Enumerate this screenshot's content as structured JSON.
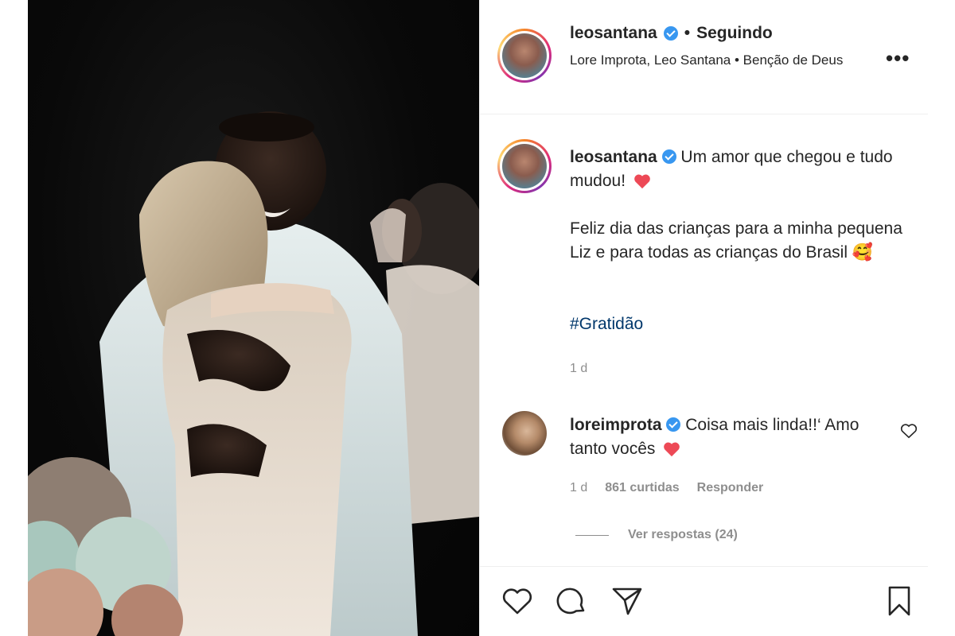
{
  "post": {
    "username": "leosantana",
    "follow_separator": "•",
    "follow_status": "Seguindo",
    "location": "Lore Improta, Leo Santana • Benção de Deus",
    "more_label": "•••"
  },
  "caption": {
    "username": "leosantana",
    "line1": "Um amor que chegou e tudo mudou!",
    "line2": "Feliz dia das crianças para a minha pequena Liz e para todas as crianças do Brasil",
    "emoji": "🥰",
    "hashtag": "#Gratidão",
    "time": "1 d"
  },
  "comment": {
    "username": "loreimprota",
    "text": "Coisa mais linda!!‘ Amo tanto vocês",
    "time": "1 d",
    "likes": "861 curtidas",
    "reply_label": "Responder",
    "view_replies": "Ver respostas (24)"
  },
  "icons": {
    "verified": "verified-badge-icon",
    "heart_red": "red-heart-emoji",
    "like": "heart-icon",
    "comment": "comment-icon",
    "share": "paper-plane-icon",
    "save": "bookmark-icon"
  },
  "colors": {
    "verified": "#3897f0",
    "hashtag": "#00376b",
    "muted": "#8e8e8e",
    "heart": "#ed4956"
  }
}
